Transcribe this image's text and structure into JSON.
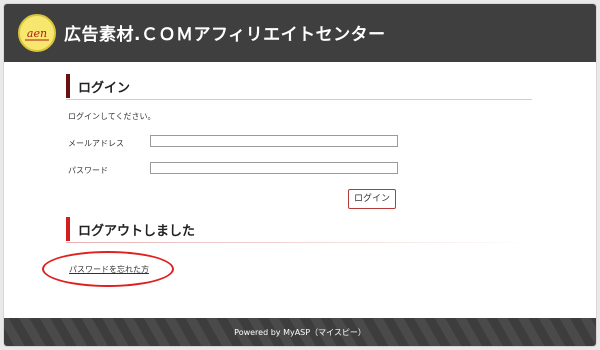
{
  "header": {
    "site_title": "広告素材.ＣＯＭアフィリエイトセンター",
    "logo_icon": "aen-logo-icon"
  },
  "login": {
    "heading": "ログイン",
    "instruction": "ログインしてください。",
    "email_label": "メールアドレス",
    "email_value": "",
    "password_label": "パスワード",
    "password_value": "",
    "button_label": "ログイン"
  },
  "logout": {
    "heading": "ログアウトしました",
    "forgot_link": "パスワードを忘れた方"
  },
  "footer": {
    "text": "Powered by MyASP（マイスピー）"
  },
  "colors": {
    "header_bg": "#3f3f3f",
    "login_accent": "#6b1010",
    "logout_accent": "#d11f1f",
    "annotation": "#e02020"
  }
}
